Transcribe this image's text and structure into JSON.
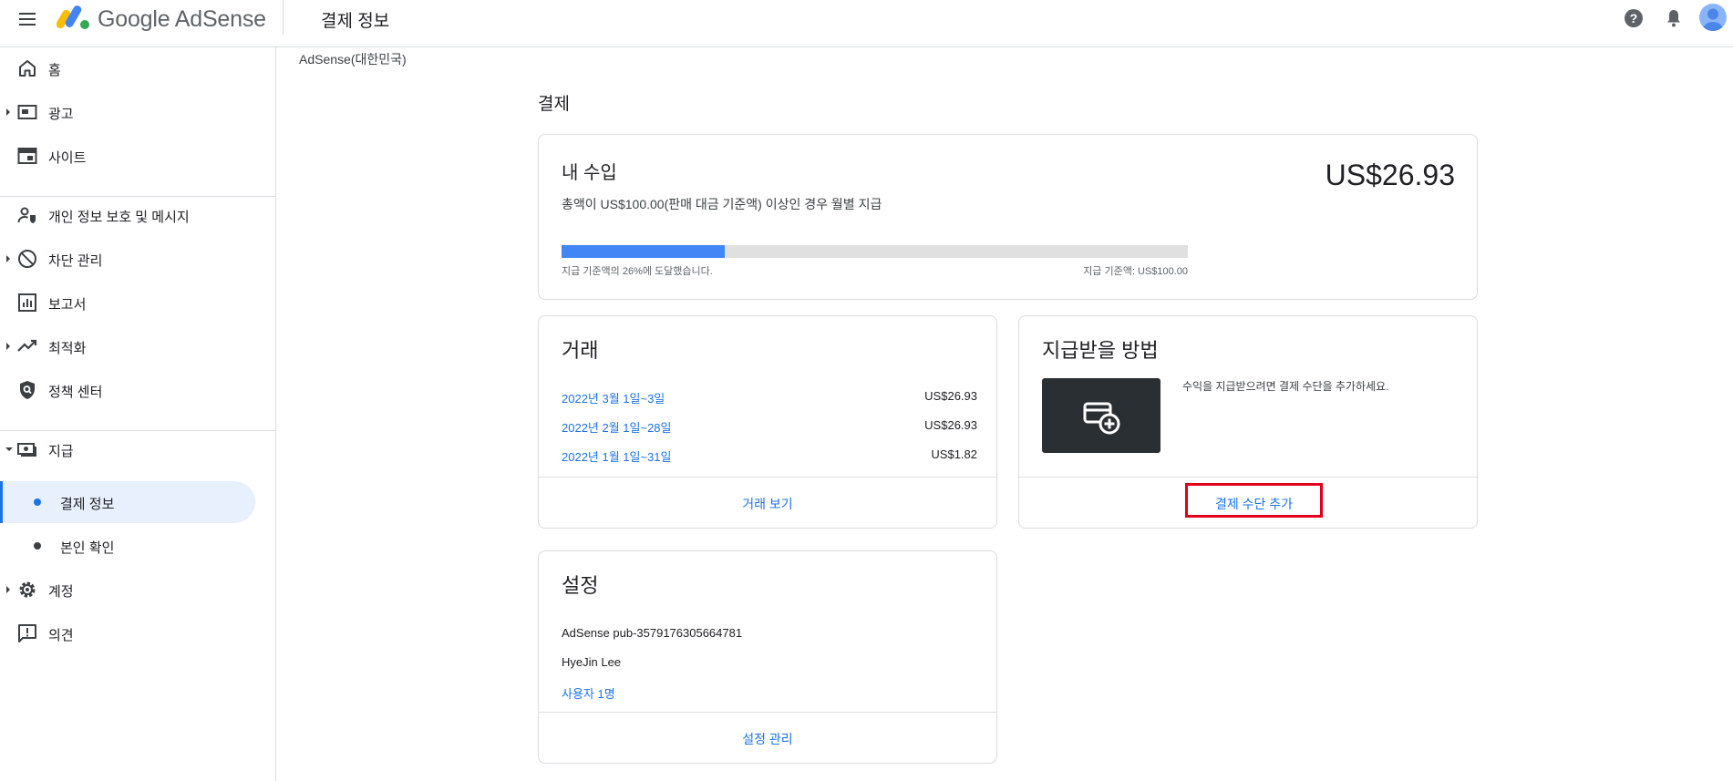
{
  "header": {
    "brand": "Google AdSense",
    "page_title": "결제 정보"
  },
  "sidebar": {
    "items": [
      {
        "label": "홈",
        "icon": "home-icon"
      },
      {
        "label": "광고",
        "icon": "ads-icon",
        "expandable": true
      },
      {
        "label": "사이트",
        "icon": "sites-icon"
      },
      {
        "label": "개인 정보 보호 및 메시지",
        "icon": "privacy-icon"
      },
      {
        "label": "차단 관리",
        "icon": "block-icon",
        "expandable": true
      },
      {
        "label": "보고서",
        "icon": "report-icon"
      },
      {
        "label": "최적화",
        "icon": "optimize-icon",
        "expandable": true
      },
      {
        "label": "정책 센터",
        "icon": "policy-shield-icon"
      },
      {
        "label": "지급",
        "icon": "payments-icon",
        "expanded": true
      },
      {
        "label": "계정",
        "icon": "gear-icon",
        "expandable": true
      },
      {
        "label": "의견",
        "icon": "feedback-icon"
      }
    ],
    "sub_items": [
      {
        "label": "결제 정보",
        "active": true
      },
      {
        "label": "본인 확인",
        "active": false
      }
    ]
  },
  "main": {
    "account_label": "AdSense(대한민국)",
    "section_title": "결제",
    "earnings": {
      "title": "내 수입",
      "amount": "US$26.93",
      "description": "총액이 US$100.00(판매 대금 기준액) 이상인 경우 월별 지급",
      "progress_percent": 26,
      "progress_left": "지급 기준액의 26%에 도달했습니다.",
      "progress_right": "지급 기준액: US$100.00"
    },
    "transactions": {
      "title": "거래",
      "rows": [
        {
          "period": "2022년 3월 1일~3일",
          "amount": "US$26.93"
        },
        {
          "period": "2022년 2월 1일~28일",
          "amount": "US$26.93"
        },
        {
          "period": "2022년 1월 1일~31일",
          "amount": "US$1.82"
        }
      ],
      "footer_link": "거래 보기"
    },
    "payment_method": {
      "title": "지급받을 방법",
      "description": "수익을 지급받으려면 결제 수단을 추가하세요.",
      "add_button": "결제 수단 추가"
    },
    "settings": {
      "title": "설정",
      "publisher_id": "AdSense pub-3579176305664781",
      "name": "HyeJin Lee",
      "users_link": "사용자 1명",
      "footer_link": "설정 관리"
    }
  },
  "colors": {
    "accent": "#1a73e8",
    "progress": "#4285f4",
    "highlight_border": "#e0001b",
    "card_tile": "#2a2f33"
  }
}
